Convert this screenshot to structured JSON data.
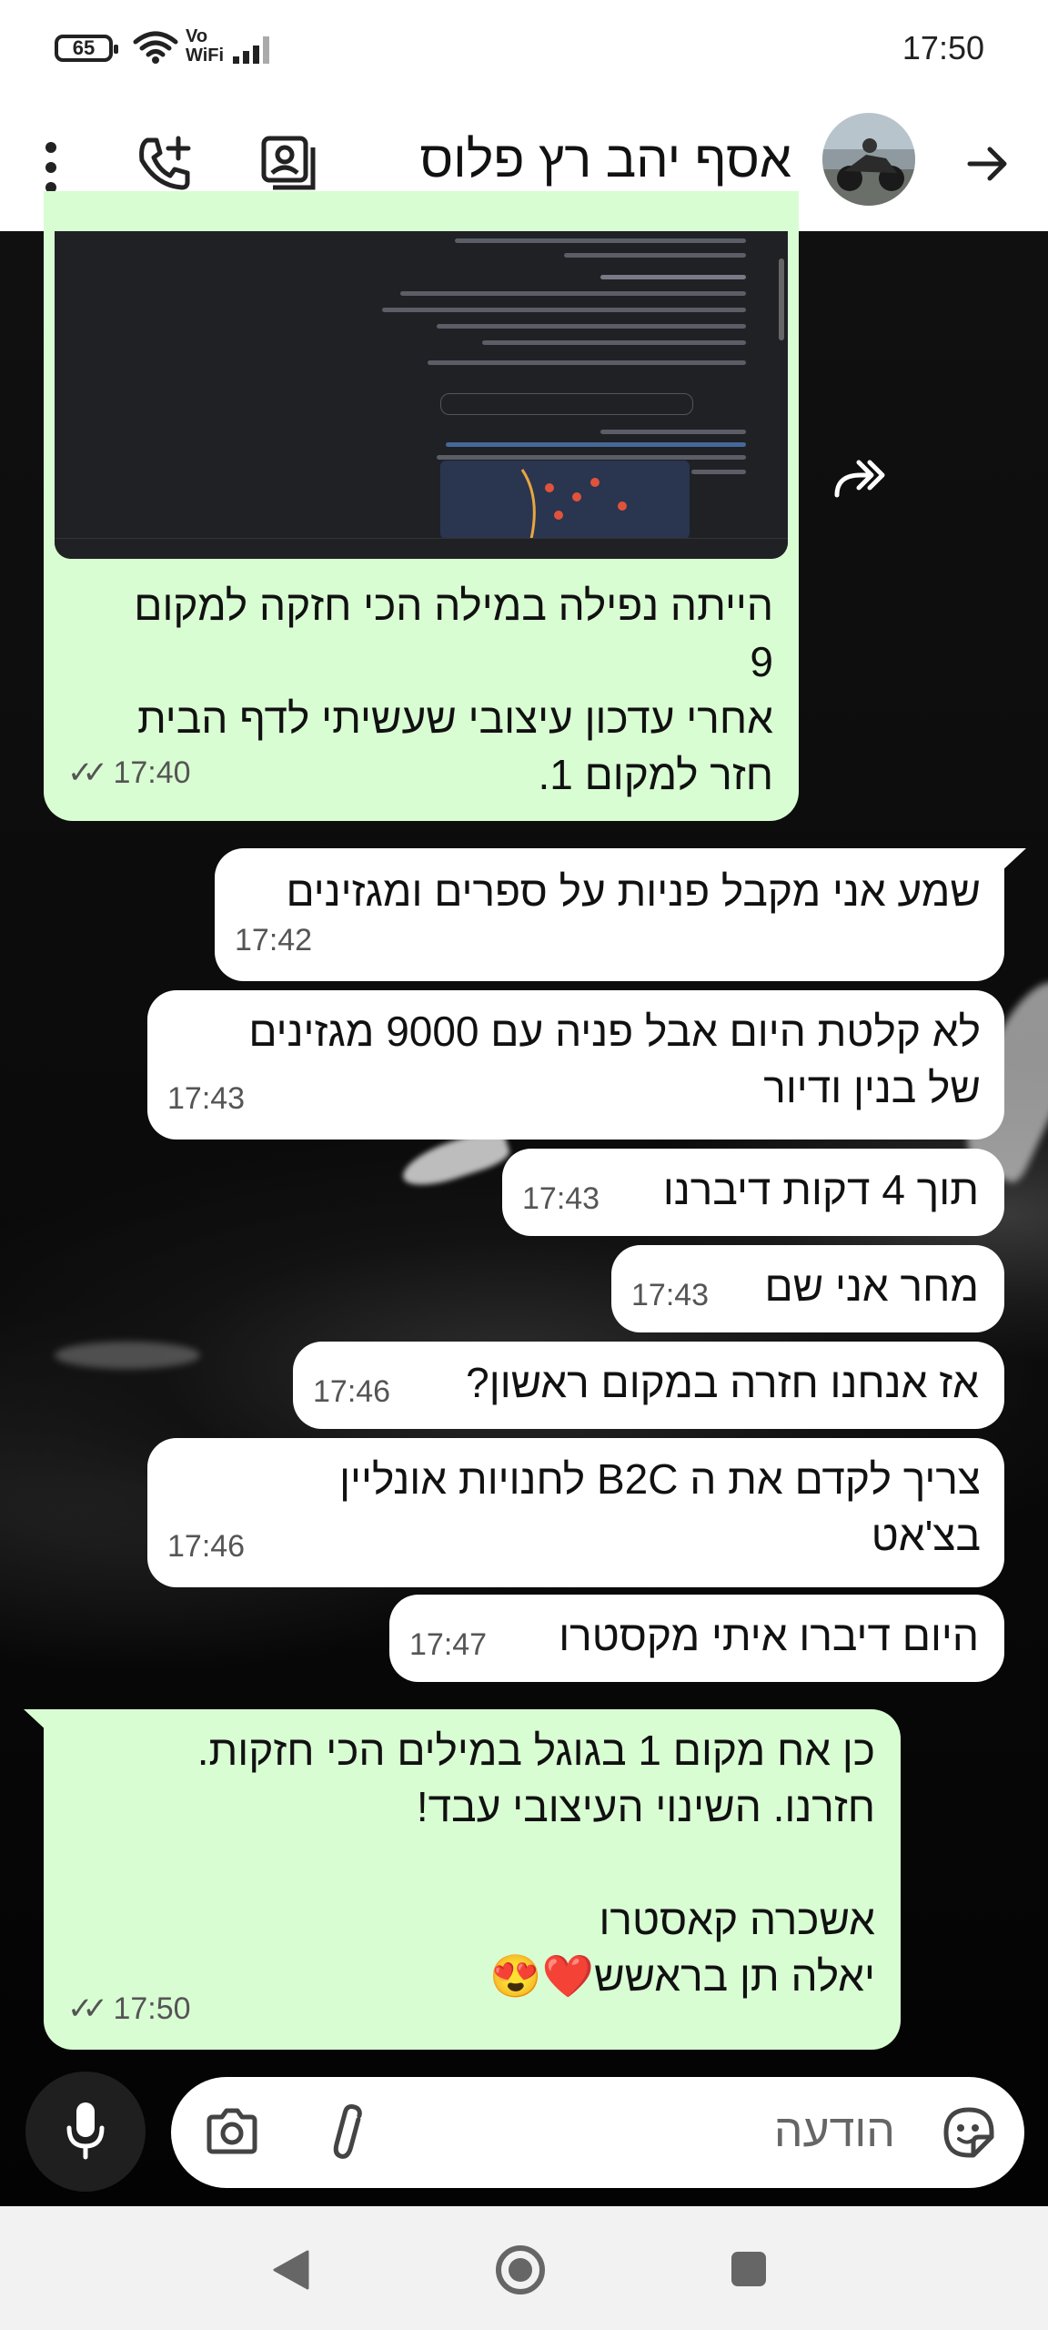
{
  "status_bar": {
    "battery": "65",
    "vowifi_line1": "Vo",
    "vowifi_line2": "WiFi",
    "time": "17:50"
  },
  "header": {
    "contact_name": "אסף יהב רץ פלוס",
    "icons": [
      "back-arrow-icon",
      "avatar",
      "contact-card-icon",
      "add-call-icon",
      "more-options-icon"
    ]
  },
  "messages": [
    {
      "dir": "out",
      "type": "image-caption",
      "text": "הייתה נפילה במילה הכי חזקה למקום\n9\nאחרי עדכון עיצובי שעשיתי לדף הבית\nחזר למקום 1.",
      "time": "17:40",
      "read": true
    },
    {
      "dir": "in",
      "text": "שמע אני מקבל פניות על ספרים ומגזינים",
      "time": "17:42"
    },
    {
      "dir": "in",
      "text": "לא קלטת היום אבל פניה עם 9000 מגזינים\nשל בנין ודיור",
      "time": "17:43"
    },
    {
      "dir": "in",
      "text": "תוך 4 דקות דיברנו",
      "time": "17:43"
    },
    {
      "dir": "in",
      "text": "מחר אני שם",
      "time": "17:43"
    },
    {
      "dir": "in",
      "text": "אז אנחנו חזרה במקום ראשון?",
      "time": "17:46"
    },
    {
      "dir": "in",
      "text": "צריך לקדם את ה B2C לחנויות אונליין\nבצ'אט",
      "time": "17:46"
    },
    {
      "dir": "in",
      "text": "היום דיברו איתי מקסטרו",
      "time": "17:47"
    },
    {
      "dir": "out",
      "text": "כן אח מקום 1 בגוגל במילים הכי חזקות.\nחזרנו. השינוי העיצובי עבד!\n\nאשכרה קאסטרו\nיאלה תן בראשש❤️😍",
      "time": "17:50",
      "read": true
    }
  ],
  "composer": {
    "placeholder": "הודעה",
    "icons": [
      "sticker-icon",
      "attach-icon",
      "camera-icon",
      "mic-icon"
    ]
  },
  "navbar": {
    "icons": [
      "nav-back-icon",
      "nav-home-icon",
      "nav-recents-icon"
    ]
  },
  "colors": {
    "outgoing_bubble": "#d9fdd3",
    "incoming_bubble": "#ffffff",
    "chat_background": "#0b0b0b"
  }
}
